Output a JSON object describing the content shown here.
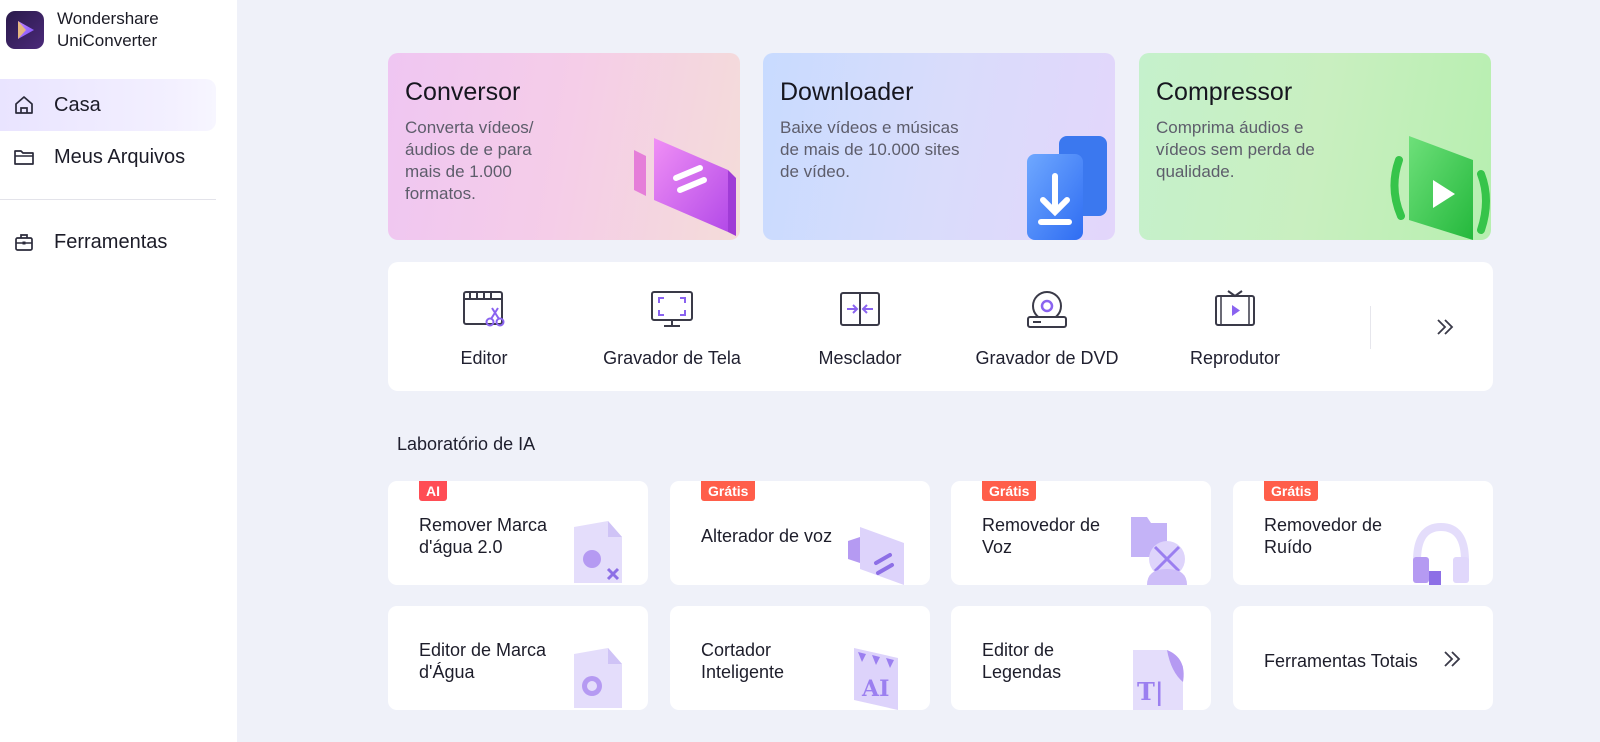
{
  "app": {
    "name_line1": "Wondershare",
    "name_line2": "UniConverter"
  },
  "sidebar": {
    "items": [
      {
        "label": "Casa",
        "icon": "home-icon",
        "active": true
      },
      {
        "label": "Meus Arquivos",
        "icon": "folder-icon",
        "active": false
      },
      {
        "label": "Ferramentas",
        "icon": "toolbox-icon",
        "active": false
      }
    ]
  },
  "hero_cards": [
    {
      "title": "Conversor",
      "description": "Converta vídeos/ áudios de e para mais de 1.000 formatos.",
      "icon": "converter-icon"
    },
    {
      "title": "Downloader",
      "description": "Baixe vídeos e músicas de mais de 10.000 sites de vídeo.",
      "icon": "downloader-icon"
    },
    {
      "title": "Compressor",
      "description": "Comprima áudios e vídeos sem perda de qualidade.",
      "icon": "compressor-icon"
    }
  ],
  "tools": [
    {
      "label": "Editor",
      "icon": "editor-scissors-icon"
    },
    {
      "label": "Gravador de Tela",
      "icon": "screen-recorder-icon"
    },
    {
      "label": "Mesclador",
      "icon": "merger-icon"
    },
    {
      "label": "Gravador de DVD",
      "icon": "dvd-burner-icon"
    },
    {
      "label": "Reprodutor",
      "icon": "player-icon"
    }
  ],
  "ai_lab": {
    "title": "Laboratório de IA",
    "cards": [
      {
        "label": "Remover Marca d'água 2.0",
        "badge": "AI",
        "icon": "watermark-remover-icon"
      },
      {
        "label": "Alterador de voz",
        "badge": "Grátis",
        "icon": "voice-changer-icon"
      },
      {
        "label": "Removedor de Voz",
        "badge": "Grátis",
        "icon": "vocal-remover-icon"
      },
      {
        "label": "Removedor de Ruído",
        "badge": "Grátis",
        "icon": "noise-remover-icon"
      },
      {
        "label": "Editor de Marca d'Água",
        "badge": "",
        "icon": "watermark-editor-icon"
      },
      {
        "label": "Cortador Inteligente",
        "badge": "",
        "icon": "smart-trimmer-icon"
      },
      {
        "label": "Editor de Legendas",
        "badge": "",
        "icon": "subtitle-editor-icon"
      },
      {
        "label": "Ferramentas Totais",
        "badge": "",
        "icon": "double-chevron-right-icon"
      }
    ]
  },
  "colors": {
    "accent": "#7b5cf0",
    "badge_red": "#ff4d55",
    "page_bg": "#eff1f9"
  }
}
